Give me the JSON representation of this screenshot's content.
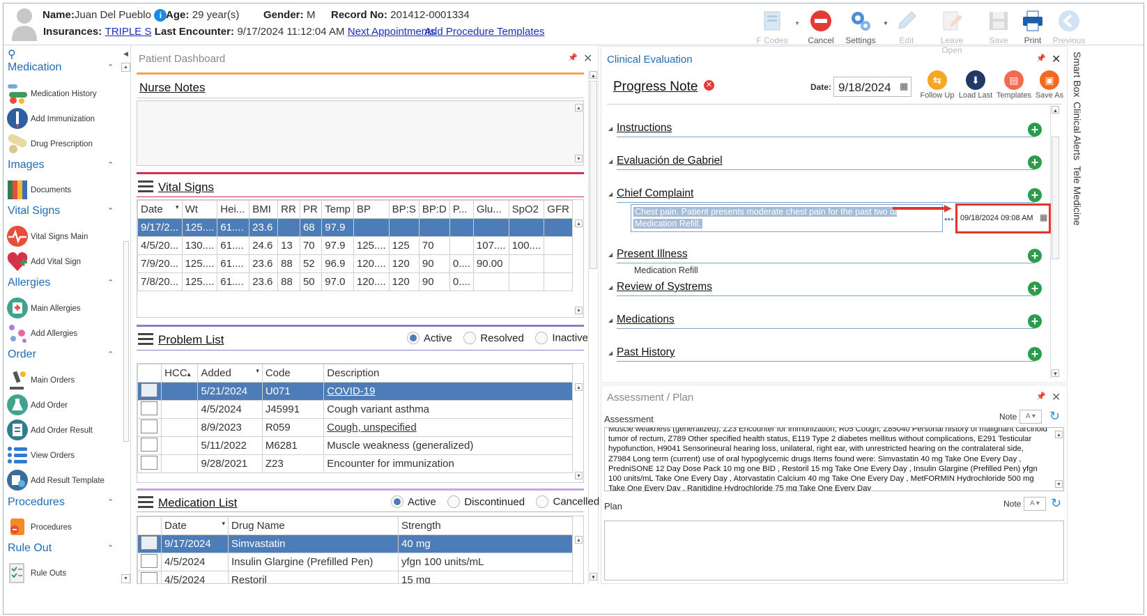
{
  "patient": {
    "name_label": "Name:",
    "name": "Juan Del Pueblo",
    "age_label": "Age:",
    "age": "29 year(s)",
    "gender_label": "Gender:",
    "gender": "M",
    "record_label": "Record No:",
    "record": "201412-0001334",
    "insurances_label": "Insurances:",
    "insurance": "TRIPLE S",
    "last_encounter_label": "Last Encounter:",
    "last_encounter": "9/17/2024 11:12:04 AM",
    "next_appointments": "Next Appointments",
    "add_procedure_templates": "Add Procedure Templates"
  },
  "toolbar": {
    "fcodes": "F Codes",
    "cancel": "Cancel",
    "settings": "Settings",
    "edit": "Edit",
    "leave_open": "Leave Open",
    "save": "Save",
    "print": "Print",
    "previous": "Previous"
  },
  "nav": {
    "medication": "Medication",
    "medication_history": "Medication History",
    "add_immunization": "Add Immunization",
    "drug_prescription": "Drug Prescription",
    "images": "Images",
    "documents": "Documents",
    "vital_signs": "Vital Signs",
    "vital_signs_main": "Vital Signs Main",
    "add_vital_sign": "Add Vital Sign",
    "allergies": "Allergies",
    "main_allergies": "Main Allergies",
    "add_allergies": "Add Allergies",
    "order": "Order",
    "main_orders": "Main Orders",
    "add_order": "Add Order",
    "add_order_result": "Add Order Result",
    "view_orders": "View Orders",
    "add_result_template": "Add Result Template",
    "procedures": "Procedures",
    "procedures_item": "Procedures",
    "rule_out": "Rule Out",
    "rule_outs": "Rule Outs"
  },
  "dashboard": {
    "title": "Patient Dashboard",
    "nurse_notes": "Nurse Notes",
    "vital_signs_title": "Vital Signs",
    "vital_columns": [
      "Date",
      "Wt",
      "Hei...",
      "BMI",
      "RR",
      "PR",
      "Temp",
      "BP",
      "BP:S",
      "BP:D",
      "P...",
      "Glu...",
      "SpO2",
      "GFR"
    ],
    "vital_rows": [
      [
        "9/17/2...",
        "125....",
        "61....",
        "23.6",
        "",
        "68",
        "97.9",
        "",
        "",
        "",
        "",
        "",
        "",
        ""
      ],
      [
        "4/5/20...",
        "130....",
        "61....",
        "24.6",
        "13",
        "70",
        "97.9",
        "125....",
        "125",
        "70",
        "",
        "107....",
        "100....",
        ""
      ],
      [
        "7/9/20...",
        "125....",
        "61....",
        "23.6",
        "88",
        "52",
        "96.9",
        "120....",
        "120",
        "90",
        "0....",
        "90.00",
        "",
        ""
      ],
      [
        "7/8/20...",
        "125....",
        "61....",
        "23.6",
        "88",
        "50",
        "97.0",
        "120....",
        "120",
        "90",
        "0....",
        "",
        "",
        ""
      ]
    ],
    "problem_list_title": "Problem List",
    "problem_filters": {
      "active": "Active",
      "resolved": "Resolved",
      "inactive": "Inactive"
    },
    "problem_columns": [
      "HCC",
      "Added",
      "Code",
      "Description"
    ],
    "problem_rows": [
      {
        "added": "5/21/2024",
        "code": "U071",
        "desc": "COVID-19"
      },
      {
        "added": "4/5/2024",
        "code": "J45991",
        "desc": "Cough variant asthma"
      },
      {
        "added": "8/9/2023",
        "code": "R059",
        "desc": "Cough, unspecified"
      },
      {
        "added": "5/11/2022",
        "code": "M6281",
        "desc": "Muscle weakness (generalized)"
      },
      {
        "added": "9/28/2021",
        "code": "Z23",
        "desc": "Encounter for immunization"
      }
    ],
    "medication_list_title": "Medication List",
    "med_filters": {
      "active": "Active",
      "discontinued": "Discontinued",
      "cancelled": "Cancelled"
    },
    "med_columns": [
      "Date",
      "Drug Name",
      "Strength"
    ],
    "med_rows": [
      {
        "date": "9/17/2024",
        "drug": "Simvastatin",
        "strength": "40 mg"
      },
      {
        "date": "4/5/2024",
        "drug": "Insulin Glargine (Prefilled Pen)",
        "strength": "yfgn 100 units/mL"
      },
      {
        "date": "4/5/2024",
        "drug": "Restoril",
        "strength": "15 mg"
      }
    ]
  },
  "clinical": {
    "title": "Clinical Evaluation",
    "progress_note": "Progress Note",
    "date_label": "Date:",
    "date_value": "9/18/2024",
    "follow_up": "Follow Up",
    "load_last": "Load Last",
    "templates": "Templates",
    "save_as": "Save As",
    "sections": {
      "instructions": "Instructions",
      "evaluacion": "Evaluación de Gabriel",
      "chief_complaint": "Chief Complaint",
      "present_illness": "Present Illness",
      "review_of_systems": "Review of Systrems",
      "medications": "Medications",
      "past_history": "Past History"
    },
    "chief_complaint_text_1": "Chest pain. Patient presents moderate chest pain for the past two days.",
    "chief_complaint_text_2": "Medication Refill.",
    "chief_complaint_datetime": "09/18/2024 09:08 AM",
    "present_illness_text": "Medication Refill"
  },
  "assessment": {
    "title": "Assessment / Plan",
    "assessment_label": "Assessment",
    "note_label": "Note",
    "text": "Muscle weakness (generalized), Z23 Encounter for immunization, R05 Cough, Z85040 Personal history of malignant carcinoid tumor of rectum, Z789 Other specified health status, E119 Type 2 diabetes mellitus without complications, E291 Testicular hypofunction, H9041 Sensorineural hearing loss, unilateral, right ear, with unrestricted hearing on the contralateral side, Z7984 Long term (current) use of oral hypoglycemic drugs  Items found were:  Simvastatin 40 mg Take One Every Day , PredniSONE 12 Day Dose Pack 10 mg one BID , Restoril 15 mg Take One Every Day , Insulin Glargine (Prefilled Pen) yfgn 100 units/mL Take One Every Day , Atorvastatin Calcium 40 mg Take One Every Day , MetFORMIN Hydrochloride 500 mg Take One Every Day , Ranitidine Hydrochloride 75 mg Take One Every Day",
    "plan_label": "Plan",
    "plan_note_label": "Note"
  },
  "sidebar_tabs": {
    "smart_box": "Smart Box",
    "clinical_alerts": "Clinical Alerts",
    "tele_medicine": "Tele Medicine"
  },
  "colors": {
    "accent_blue": "#4d7db9",
    "link_blue": "#1a2fb8",
    "orange_line": "#f0a35c",
    "red_line": "#c9334f",
    "purple_line": "#8e7cc3",
    "plus_green": "#2a9d4c",
    "highlight_red": "#e0362c"
  }
}
